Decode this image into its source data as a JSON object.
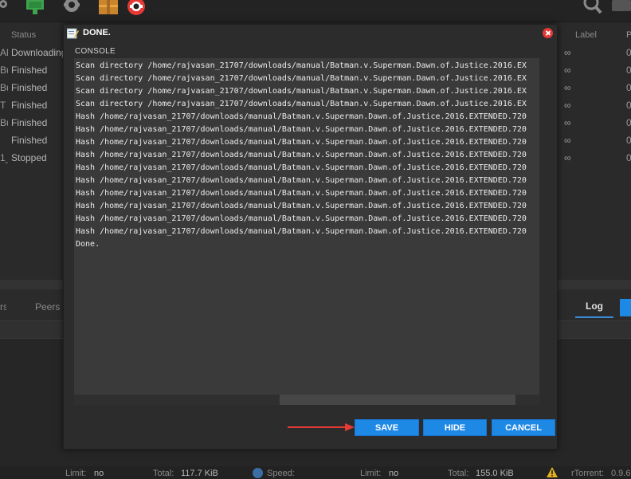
{
  "toolbar": {
    "icons": [
      "gear-icon",
      "flag-icon",
      "settings-icon",
      "box-icon",
      "help-icon",
      "search-icon"
    ]
  },
  "torrents": {
    "columns": {
      "status": "Status",
      "label": "Label",
      "last": "P"
    },
    "rows": [
      {
        "lead": "Al",
        "status": "Downloading",
        "ratio": "∞",
        "last": "0"
      },
      {
        "lead": "Bu",
        "status": "Finished",
        "ratio": "∞",
        "last": "0"
      },
      {
        "lead": "Bu",
        "status": "Finished",
        "ratio": "∞",
        "last": "0"
      },
      {
        "lead": "T",
        "status": "Finished",
        "ratio": "∞",
        "last": "0"
      },
      {
        "lead": "Bu",
        "status": "Finished",
        "ratio": "∞",
        "last": "0"
      },
      {
        "lead": "",
        "status": "Finished",
        "ratio": "∞",
        "last": "0"
      },
      {
        "lead": "1_",
        "status": "Stopped",
        "ratio": "∞",
        "last": "0"
      }
    ]
  },
  "bottom_tabs": {
    "cut_left": "rs",
    "peers": "Peers",
    "log": "Log"
  },
  "statusbar": {
    "ul_limit_label": "Limit:",
    "ul_limit_value": "no",
    "ul_total_label": "Total:",
    "ul_total_value": "117.7 KiB",
    "dl_speed_label": "Speed:",
    "dl_limit_label": "Limit:",
    "dl_limit_value": "no",
    "dl_total_label": "Total:",
    "dl_total_value": "155.0 KiB",
    "app_label": "rTorrent:",
    "app_version": "0.9.6"
  },
  "dialog": {
    "title": "DONE.",
    "console_label": "CONSOLE",
    "console_lines": [
      "Scan directory /home/rajvasan_21707/downloads/manual/Batman.v.Superman.Dawn.of.Justice.2016.EX",
      "Scan directory /home/rajvasan_21707/downloads/manual/Batman.v.Superman.Dawn.of.Justice.2016.EX",
      "Scan directory /home/rajvasan_21707/downloads/manual/Batman.v.Superman.Dawn.of.Justice.2016.EX",
      "Scan directory /home/rajvasan_21707/downloads/manual/Batman.v.Superman.Dawn.of.Justice.2016.EX",
      "Hash /home/rajvasan_21707/downloads/manual/Batman.v.Superman.Dawn.of.Justice.2016.EXTENDED.720",
      "Hash /home/rajvasan_21707/downloads/manual/Batman.v.Superman.Dawn.of.Justice.2016.EXTENDED.720",
      "Hash /home/rajvasan_21707/downloads/manual/Batman.v.Superman.Dawn.of.Justice.2016.EXTENDED.720",
      "Hash /home/rajvasan_21707/downloads/manual/Batman.v.Superman.Dawn.of.Justice.2016.EXTENDED.720",
      "Hash /home/rajvasan_21707/downloads/manual/Batman.v.Superman.Dawn.of.Justice.2016.EXTENDED.720",
      "Hash /home/rajvasan_21707/downloads/manual/Batman.v.Superman.Dawn.of.Justice.2016.EXTENDED.720",
      "Hash /home/rajvasan_21707/downloads/manual/Batman.v.Superman.Dawn.of.Justice.2016.EXTENDED.720",
      "Hash /home/rajvasan_21707/downloads/manual/Batman.v.Superman.Dawn.of.Justice.2016.EXTENDED.720",
      "Hash /home/rajvasan_21707/downloads/manual/Batman.v.Superman.Dawn.of.Justice.2016.EXTENDED.720",
      "Hash /home/rajvasan_21707/downloads/manual/Batman.v.Superman.Dawn.of.Justice.2016.EXTENDED.720",
      "Done."
    ],
    "buttons": {
      "save": "SAVE",
      "hide": "HIDE",
      "cancel": "CANCEL"
    },
    "colors": {
      "button": "#1e88e5",
      "close": "#e53935",
      "arrow": "#e53935"
    }
  }
}
